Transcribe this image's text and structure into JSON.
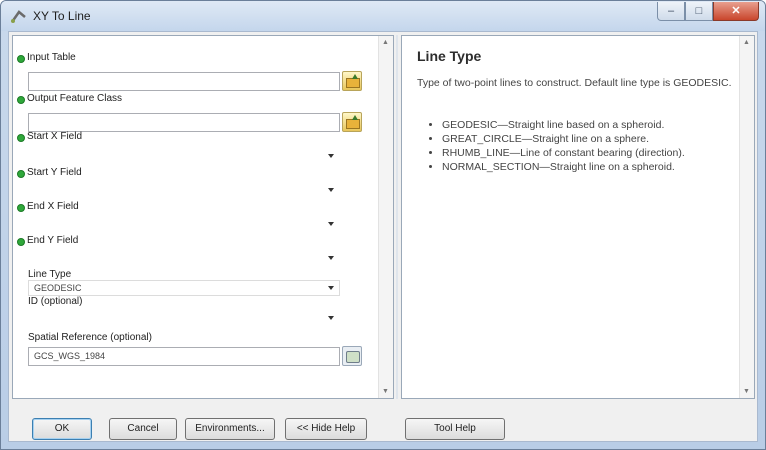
{
  "window": {
    "title": "XY To Line"
  },
  "params": [
    {
      "id": "input-table",
      "label": "Input Table",
      "value": "",
      "required": true,
      "control": "browse"
    },
    {
      "id": "output-feature-class",
      "label": "Output Feature Class",
      "value": "",
      "required": true,
      "control": "browse"
    },
    {
      "id": "start-x-field",
      "label": "Start X Field",
      "value": "",
      "required": true,
      "control": "combo"
    },
    {
      "id": "start-y-field",
      "label": "Start Y Field",
      "value": "",
      "required": true,
      "control": "combo"
    },
    {
      "id": "end-x-field",
      "label": "End X Field",
      "value": "",
      "required": true,
      "control": "combo"
    },
    {
      "id": "end-y-field",
      "label": "End Y Field",
      "value": "",
      "required": true,
      "control": "combo"
    },
    {
      "id": "line-type",
      "label": "Line Type",
      "value": "GEODESIC",
      "required": false,
      "control": "combo"
    },
    {
      "id": "id-optional",
      "label": "ID (optional)",
      "value": "",
      "required": false,
      "control": "combo"
    },
    {
      "id": "spatial-reference",
      "label": "Spatial Reference (optional)",
      "value": "GCS_WGS_1984",
      "required": false,
      "control": "sr"
    }
  ],
  "help": {
    "title": "Line Type",
    "description": "Type of two-point lines to construct. Default line type is GEODESIC.",
    "items": [
      "GEODESIC—Straight line based on a spheroid.",
      "GREAT_CIRCLE—Straight line on a sphere.",
      "RHUMB_LINE—Line of constant bearing (direction).",
      "NORMAL_SECTION—Straight line on a spheroid."
    ]
  },
  "buttons": {
    "ok": "OK",
    "cancel": "Cancel",
    "environments": "Environments...",
    "hide_help": "<< Hide Help",
    "tool_help": "Tool Help"
  },
  "colors": {
    "required_dot": "#2fa83a",
    "titlebar": "#c4d6ec",
    "close_button": "#c9462c"
  },
  "icons": [
    "tool-icon",
    "minimize-icon",
    "maximize-icon",
    "close-icon",
    "browse-folder-icon",
    "spatial-reference-icon",
    "scroll-up-icon",
    "scroll-down-icon",
    "dropdown-arrow-icon"
  ]
}
